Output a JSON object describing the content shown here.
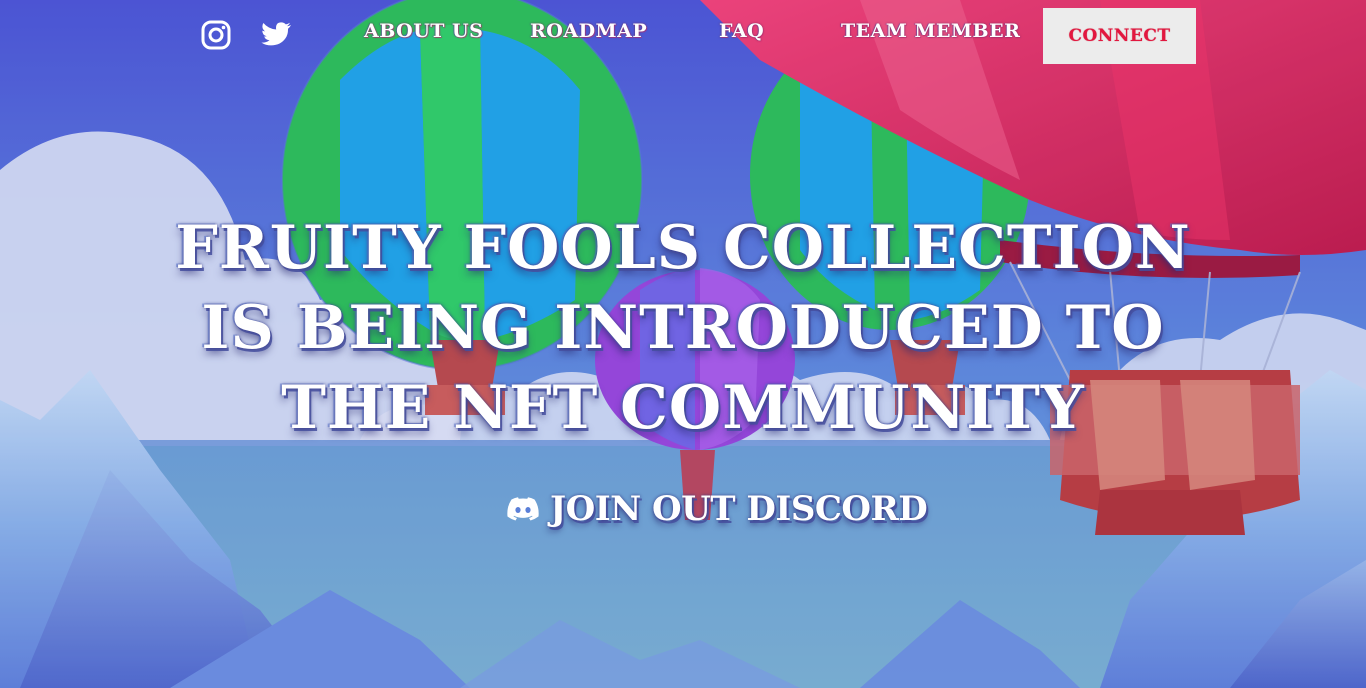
{
  "nav": {
    "social": [
      {
        "icon": "instagram-icon"
      },
      {
        "icon": "twitter-icon"
      }
    ],
    "links": [
      {
        "label": "ABOUT US"
      },
      {
        "label": "ROADMAP"
      },
      {
        "label": "FAQ"
      },
      {
        "label": "TEAM MEMBER"
      }
    ],
    "connect_label": "CONNECT"
  },
  "hero": {
    "title": "FRUITY FOOLS COLLECTION IS BEING INTRODUCED TO THE NFT COMMUNITY"
  },
  "discord": {
    "icon": "discord-icon",
    "label": "JOIN OUT DISCORD"
  },
  "colors": {
    "sky_top": "#4a4fd2",
    "sky_bottom": "#5ea9d8",
    "connect_text": "#e2173f",
    "balloon_red": "#e0164a"
  }
}
